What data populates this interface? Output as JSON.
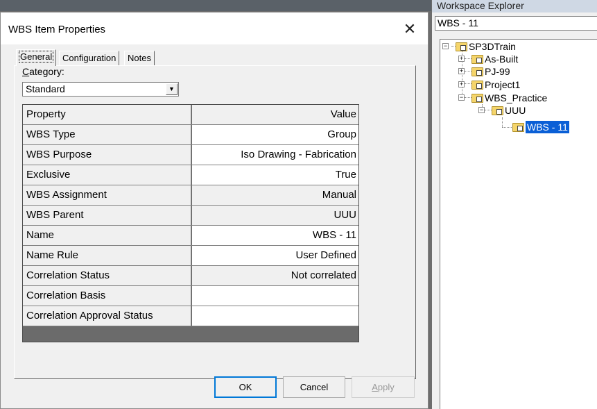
{
  "dialog": {
    "title": "WBS Item Properties",
    "close_glyph": "✕",
    "tabs": [
      {
        "label": "General",
        "active": true
      },
      {
        "label": "Configuration",
        "active": false
      },
      {
        "label": "Notes",
        "active": false
      }
    ],
    "category": {
      "label_prefix": "C",
      "label_rest": "ategory:",
      "selected": "Standard",
      "arrow_glyph": "▼"
    },
    "grid": {
      "header": {
        "name": "Property",
        "value": "Value"
      },
      "rows": [
        {
          "name": "WBS Type",
          "value": "Group"
        },
        {
          "name": "WBS Purpose",
          "value": "Iso Drawing - Fabrication"
        },
        {
          "name": "Exclusive",
          "value": "True"
        },
        {
          "name": "WBS Assignment",
          "value": "Manual"
        },
        {
          "name": "WBS Parent",
          "value": "UUU"
        },
        {
          "name": "Name",
          "value": "WBS - 11"
        },
        {
          "name": "Name Rule",
          "value": "User Defined"
        },
        {
          "name": "Correlation Status",
          "value": "Not correlated"
        },
        {
          "name": "Correlation Basis",
          "value": ""
        },
        {
          "name": "Correlation Approval Status",
          "value": ""
        }
      ]
    },
    "buttons": {
      "ok": "OK",
      "cancel": "Cancel",
      "apply_prefix": "A",
      "apply_rest": "pply"
    }
  },
  "explorer": {
    "title": "Workspace Explorer",
    "input_value": "WBS - 11",
    "tree": {
      "root": "SP3DTrain",
      "children": [
        "As-Built",
        "PJ-99",
        "Project1",
        "WBS_Practice"
      ],
      "grandchild": "UUU",
      "selected": "WBS - 11",
      "collapsed_glyph": "+",
      "expanded_glyph": "−"
    }
  }
}
